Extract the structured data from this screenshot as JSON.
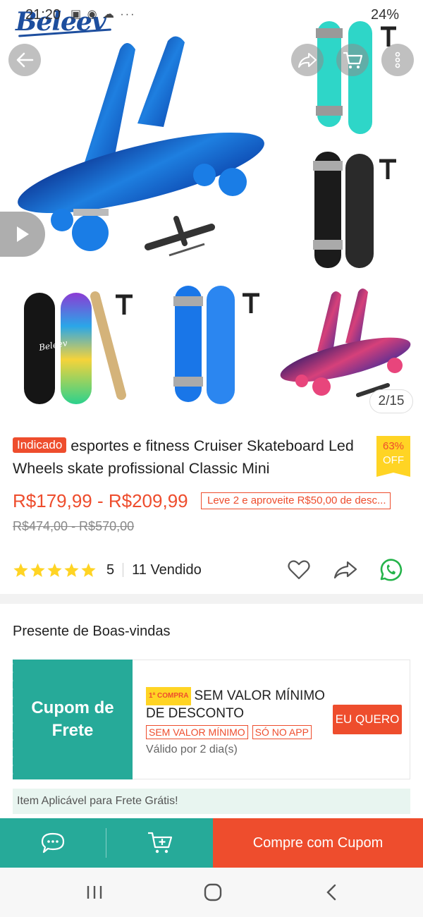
{
  "status_bar": {
    "time": "21:20",
    "battery": "24%"
  },
  "gallery": {
    "brand_logo": "Beleev",
    "counter": "2/15",
    "colors": {
      "galaxy_blue": "#1e6fd6",
      "teal": "#2ed6c8",
      "black": "#1b1b1b",
      "blue": "#1976e8",
      "pink": "#e8457c"
    }
  },
  "product": {
    "badge": "Indicado",
    "title": "esportes e fitness Cruiser Skateboard Led Wheels skate profissional Classic Mini",
    "discount_pct": "63%",
    "discount_off": "OFF",
    "price_range": "R$179,99 - R$209,99",
    "promo": "Leve 2 e aproveite R$50,00 de desc...",
    "old_price_range": "R$474,00 - R$570,00",
    "rating": "5",
    "stars": 5,
    "sold": "11 Vendido"
  },
  "welcome": {
    "title": "Presente de Boas-vindas",
    "coupon_title": "Cupom de Frete",
    "first_buy_tag": "1ª COMPRA",
    "coupon_text": "SEM VALOR MÍNIMO DE DESCONTO",
    "tags": [
      "SEM VALOR MÍNIMO",
      "SÓ NO APP"
    ],
    "validity": "Válido por 2 dia(s)",
    "claim_button": "EU QUERO",
    "free_shipping_note": "Item Aplicável para Frete Grátis!"
  },
  "bottom_bar": {
    "buy_label": "Compre com Cupom"
  },
  "theme": {
    "accent": "#ee4d2d",
    "teal": "#26aa99",
    "gold": "#ffd424"
  }
}
